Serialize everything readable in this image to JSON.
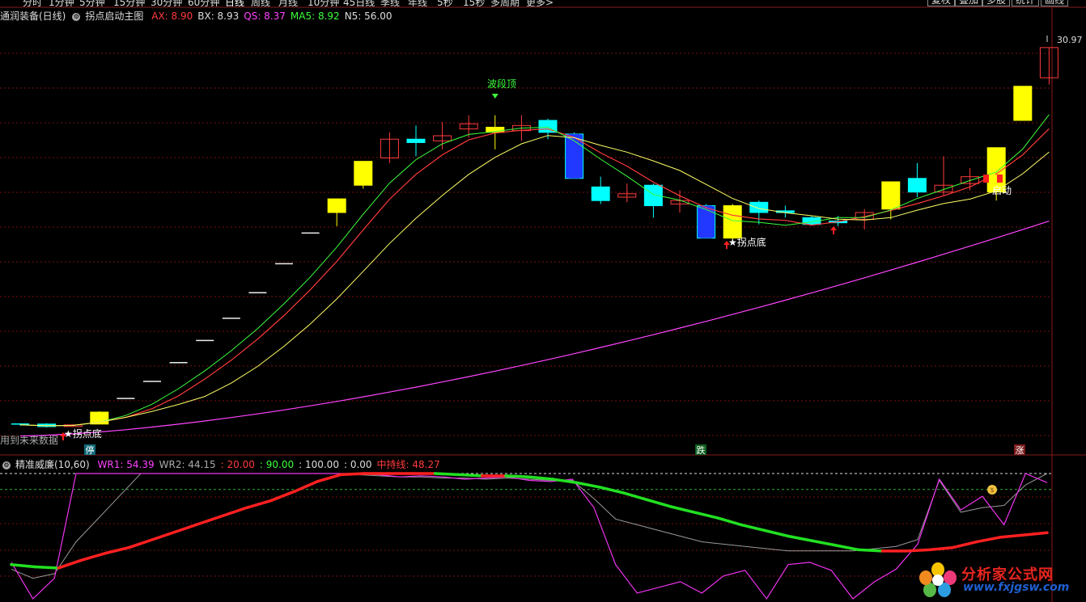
{
  "toolbar": {
    "periods": [
      "分时",
      "1分钟",
      "5分钟",
      "15分钟",
      "30分钟",
      "60分钟",
      "日线",
      "周线",
      "月线",
      "10分钟",
      "45日线",
      "季线",
      "年线",
      "5秒",
      "15秒",
      "多周期",
      "更多>"
    ],
    "active_period": "日线",
    "right_buttons": [
      "复权",
      "叠加",
      "多股",
      "统计",
      "画线"
    ]
  },
  "main_legend": {
    "stock": "通润装备(日线)",
    "indicator": "拐点启动主图",
    "items": [
      {
        "label": "AX: 8.90",
        "color": "#ff3b3b"
      },
      {
        "label": "BX: 8.93",
        "color": "#dddddd"
      },
      {
        "label": "QS: 8.37",
        "color": "#ff44ff"
      },
      {
        "label": "MA5: 8.92",
        "color": "#3cff3c"
      },
      {
        "label": "N5: 56.00",
        "color": "#dddddd"
      }
    ]
  },
  "sub_legend": {
    "name": "精准威廉(10,60)",
    "items": [
      {
        "label": "WR1: 54.39",
        "color": "#ff44ff"
      },
      {
        "label": "WR2: 44.15",
        "color": "#aaaaaa"
      },
      {
        "label": ": 20.00",
        "color": "#ff3b3b"
      },
      {
        "label": ": 90.00",
        "color": "#3cff3c"
      },
      {
        "label": ": 100.00",
        "color": "#dddddd"
      },
      {
        "label": ": 0.00",
        "color": "#dddddd"
      },
      {
        "label": "中持线: 48.27",
        "color": "#ff3b3b"
      }
    ]
  },
  "annotations": {
    "price_high": "30.97",
    "wave_top": "波段顶",
    "turn_bottom_1": "拐点底",
    "turn_bottom_2": "拐点底",
    "launch": "启动",
    "future_data": "用到未来数据",
    "badge_stop": "停",
    "badge_fall": "跌",
    "badge_rise": "涨"
  },
  "watermark": {
    "title": "分析家公式网",
    "url": "www.fxjgsw.com"
  },
  "colors": {
    "up_candle": "#ff3b3b",
    "down_candle": "#00ffff",
    "signal_yellow": "#ffff00",
    "signal_blue": "#1a3cff",
    "ma_yellow": "#ffff66",
    "ma_red": "#ff3b3b",
    "ma_green": "#3cff3c",
    "qs_magenta": "#ff44ff",
    "grid": "#7a1010"
  },
  "chart_data": [
    {
      "type": "candlestick",
      "title": "拐点启动主图",
      "ohlc_estimated": [
        {
          "o": 8.9,
          "c": 8.85,
          "h": 8.95,
          "l": 8.8,
          "style": "flat"
        },
        {
          "o": 8.9,
          "c": 8.75,
          "h": 8.95,
          "l": 8.7,
          "style": "down"
        },
        {
          "o": 8.8,
          "c": 8.85,
          "h": 8.9,
          "l": 8.75,
          "style": "up"
        },
        {
          "o": 8.9,
          "c": 9.6,
          "h": 9.65,
          "l": 8.9,
          "style": "yellow"
        },
        {
          "o": 10.4,
          "c": 10.4,
          "h": 10.4,
          "l": 10.4,
          "style": "limit"
        },
        {
          "o": 11.4,
          "c": 11.4,
          "h": 11.4,
          "l": 11.4,
          "style": "limit"
        },
        {
          "o": 12.5,
          "c": 12.5,
          "h": 12.5,
          "l": 12.5,
          "style": "limit"
        },
        {
          "o": 13.8,
          "c": 13.8,
          "h": 13.8,
          "l": 13.8,
          "style": "limit"
        },
        {
          "o": 15.1,
          "c": 15.1,
          "h": 15.1,
          "l": 15.1,
          "style": "limit"
        },
        {
          "o": 16.6,
          "c": 16.6,
          "h": 16.6,
          "l": 16.6,
          "style": "limit"
        },
        {
          "o": 18.3,
          "c": 18.3,
          "h": 18.3,
          "l": 18.3,
          "style": "limit"
        },
        {
          "o": 20.1,
          "c": 20.1,
          "h": 20.1,
          "l": 20.1,
          "style": "limit"
        },
        {
          "o": 21.3,
          "c": 22.1,
          "h": 22.1,
          "l": 20.5,
          "style": "yellow"
        },
        {
          "o": 22.9,
          "c": 24.3,
          "h": 24.3,
          "l": 22.7,
          "style": "yellow"
        },
        {
          "o": 24.5,
          "c": 25.6,
          "h": 26.0,
          "l": 24.2,
          "style": "up"
        },
        {
          "o": 25.4,
          "c": 25.6,
          "h": 26.4,
          "l": 24.6,
          "style": "down"
        },
        {
          "o": 25.5,
          "c": 25.8,
          "h": 26.6,
          "l": 25.0,
          "style": "up"
        },
        {
          "o": 26.2,
          "c": 26.5,
          "h": 27.0,
          "l": 25.7,
          "style": "up"
        },
        {
          "o": 26.0,
          "c": 26.3,
          "h": 27.0,
          "l": 25.0,
          "style": "yellow"
        },
        {
          "o": 26.1,
          "c": 26.4,
          "h": 27.0,
          "l": 25.5,
          "style": "up"
        },
        {
          "o": 26.7,
          "c": 26.0,
          "h": 26.8,
          "l": 25.6,
          "style": "down"
        },
        {
          "o": 25.9,
          "c": 23.3,
          "h": 26.0,
          "l": 23.3,
          "style": "blue"
        },
        {
          "o": 22.8,
          "c": 22.0,
          "h": 23.4,
          "l": 21.8,
          "style": "down"
        },
        {
          "o": 22.2,
          "c": 22.4,
          "h": 23.0,
          "l": 21.9,
          "style": "up"
        },
        {
          "o": 22.9,
          "c": 21.7,
          "h": 23.0,
          "l": 21.0,
          "style": "down"
        },
        {
          "o": 21.8,
          "c": 22.0,
          "h": 22.6,
          "l": 21.3,
          "style": "up"
        },
        {
          "o": 21.7,
          "c": 19.8,
          "h": 21.8,
          "l": 19.8,
          "style": "blue"
        },
        {
          "o": 21.7,
          "c": 19.8,
          "h": 21.8,
          "l": 19.7,
          "style": "yellow"
        },
        {
          "o": 21.9,
          "c": 21.3,
          "h": 22.0,
          "l": 20.6,
          "style": "down"
        },
        {
          "o": 21.4,
          "c": 21.3,
          "h": 21.7,
          "l": 21.0,
          "style": "down"
        },
        {
          "o": 21.0,
          "c": 20.6,
          "h": 21.1,
          "l": 20.6,
          "style": "down"
        },
        {
          "o": 20.7,
          "c": 20.8,
          "h": 21.1,
          "l": 20.5,
          "style": "down"
        },
        {
          "o": 20.9,
          "c": 21.3,
          "h": 21.5,
          "l": 20.3,
          "style": "up"
        },
        {
          "o": 21.5,
          "c": 23.1,
          "h": 23.1,
          "l": 20.9,
          "style": "yellow"
        },
        {
          "o": 22.5,
          "c": 23.3,
          "h": 24.2,
          "l": 22.2,
          "style": "down"
        },
        {
          "o": 22.5,
          "c": 22.9,
          "h": 24.6,
          "l": 22.3,
          "style": "up"
        },
        {
          "o": 23.0,
          "c": 23.4,
          "h": 23.9,
          "l": 22.6,
          "style": "up"
        },
        {
          "o": 22.5,
          "c": 25.1,
          "h": 25.1,
          "l": 22.0,
          "style": "yellow"
        },
        {
          "o": 26.7,
          "c": 28.7,
          "h": 28.7,
          "l": 26.7,
          "style": "yellow"
        },
        {
          "o": 29.2,
          "c": 30.97,
          "h": 30.97,
          "l": 28.8,
          "style": "up"
        }
      ],
      "lines": [
        "AX",
        "BX",
        "QS",
        "MA5"
      ]
    },
    {
      "type": "line",
      "title": "精准威廉(10,60)",
      "series": [
        {
          "name": "WR1",
          "values": [
            22,
            -10,
            8,
            100,
            100,
            100,
            100,
            100,
            100,
            100,
            100,
            100,
            100,
            100,
            100,
            100,
            100,
            99,
            97,
            98,
            97,
            95,
            96,
            97,
            94,
            93,
            95,
            70,
            20,
            -5,
            0,
            5,
            -5,
            10,
            15,
            -10,
            20,
            22,
            15,
            -10,
            5,
            16,
            38,
            95,
            68,
            80,
            55,
            100,
            92
          ]
        },
        {
          "name": "WR2",
          "values": [
            16,
            8,
            12,
            40,
            60,
            80,
            100,
            100,
            100,
            100,
            100,
            100,
            100,
            100,
            100,
            100,
            99,
            98,
            97,
            97,
            96,
            96,
            95,
            96,
            95,
            94,
            94,
            78,
            60,
            55,
            50,
            45,
            40,
            38,
            36,
            34,
            32,
            32,
            32,
            32,
            34,
            36,
            42,
            94,
            66,
            70,
            72,
            90,
            100
          ]
        },
        {
          "name": "中持线",
          "values": [
            20,
            18,
            17,
            24,
            30,
            35,
            42,
            49,
            56,
            63,
            70,
            76,
            84,
            93,
            99,
            100,
            100,
            100,
            100,
            99,
            98,
            98,
            97,
            95,
            92,
            88,
            83,
            77,
            71,
            66,
            61,
            55,
            50,
            45,
            41,
            37,
            33,
            32,
            32,
            33,
            35,
            40,
            44,
            46,
            48
          ]
        }
      ],
      "levels": [
        20,
        90,
        100,
        0
      ],
      "ylim": [
        -10,
        100
      ]
    }
  ]
}
